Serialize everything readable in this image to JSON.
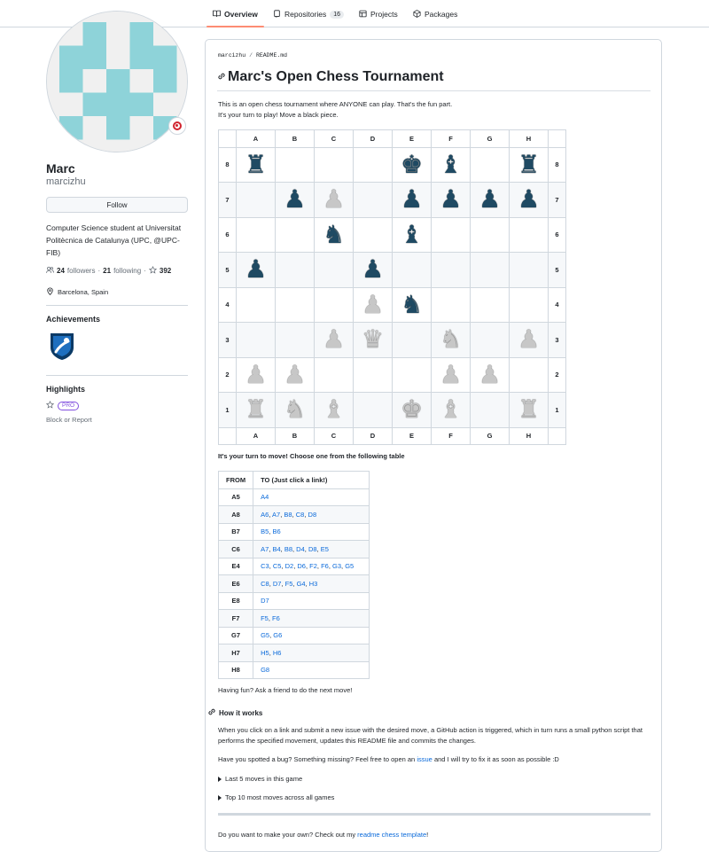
{
  "nav": {
    "tabs": [
      {
        "label": "Overview",
        "icon": "book-icon",
        "selected": true
      },
      {
        "label": "Repositories",
        "icon": "repo-icon",
        "count": "16"
      },
      {
        "label": "Projects",
        "icon": "table-icon"
      },
      {
        "label": "Packages",
        "icon": "package-icon"
      }
    ]
  },
  "profile": {
    "name": "Marc",
    "login": "marcizhu",
    "follow_label": "Follow",
    "bio": "Computer Science student at Universitat Politècnica de Catalunya (UPC, @UPC-FIB)",
    "followers_count": "24",
    "followers_label": "followers",
    "dot": "·",
    "following_count": "21",
    "following_label": "following",
    "stars_count": "392",
    "location": "Barcelona, Spain",
    "achievements_heading": "Achievements",
    "highlights_heading": "Highlights",
    "pro_label": "PRO",
    "block_label": "Block or Report",
    "avatar_color": "#8ed3d9"
  },
  "readme": {
    "breadcrumb_owner": "marcizhu",
    "breadcrumb_sep": "/",
    "breadcrumb_file": "README.md",
    "title": "Marc's Open Chess Tournament",
    "intro_1": "This is an open chess tournament where ANYONE can play. That's the fun part.",
    "intro_2": "It's your turn to play! Move a black piece.",
    "board": {
      "files": [
        "A",
        "B",
        "C",
        "D",
        "E",
        "F",
        "G",
        "H"
      ],
      "rows": [
        {
          "rank": "8",
          "squares": [
            "bR",
            "",
            "",
            "",
            "bK",
            "bB",
            "",
            "bR"
          ]
        },
        {
          "rank": "7",
          "squares": [
            "",
            "bP",
            "wP",
            "",
            "bP",
            "bP",
            "bP",
            "bP"
          ]
        },
        {
          "rank": "6",
          "squares": [
            "",
            "",
            "bN",
            "",
            "bB",
            "",
            "",
            ""
          ]
        },
        {
          "rank": "5",
          "squares": [
            "bP",
            "",
            "",
            "bP",
            "",
            "",
            "",
            ""
          ]
        },
        {
          "rank": "4",
          "squares": [
            "",
            "",
            "",
            "wP",
            "bN",
            "",
            "",
            ""
          ]
        },
        {
          "rank": "3",
          "squares": [
            "",
            "",
            "wP",
            "wQ",
            "",
            "wN",
            "",
            "wP"
          ]
        },
        {
          "rank": "2",
          "squares": [
            "wP",
            "wP",
            "",
            "",
            "",
            "wP",
            "wP",
            ""
          ]
        },
        {
          "rank": "1",
          "squares": [
            "wR",
            "wN",
            "wB",
            "",
            "wK",
            "wB",
            "",
            "wR"
          ]
        }
      ]
    },
    "turn_text": "It's your turn to move! Choose one from the following table",
    "moves_header_from": "FROM",
    "moves_header_to": "TO (Just click a link!)",
    "moves": [
      {
        "from": "A5",
        "to": [
          "A4"
        ]
      },
      {
        "from": "A8",
        "to": [
          "A6",
          "A7",
          "B8",
          "C8",
          "D8"
        ]
      },
      {
        "from": "B7",
        "to": [
          "B5",
          "B6"
        ]
      },
      {
        "from": "C6",
        "to": [
          "A7",
          "B4",
          "B8",
          "D4",
          "D8",
          "E5"
        ]
      },
      {
        "from": "E4",
        "to": [
          "C3",
          "C5",
          "D2",
          "D6",
          "F2",
          "F6",
          "G3",
          "G5"
        ]
      },
      {
        "from": "E6",
        "to": [
          "C8",
          "D7",
          "F5",
          "G4",
          "H3"
        ]
      },
      {
        "from": "E8",
        "to": [
          "D7"
        ]
      },
      {
        "from": "F7",
        "to": [
          "F5",
          "F6"
        ]
      },
      {
        "from": "G7",
        "to": [
          "G5",
          "G6"
        ]
      },
      {
        "from": "H7",
        "to": [
          "H5",
          "H6"
        ]
      },
      {
        "from": "H8",
        "to": [
          "G8"
        ]
      }
    ],
    "fun_text": "Having fun? Ask a friend to do the next move!",
    "how_heading": "How it works",
    "how_text": "When you click on a link and submit a new issue with the desired move, a GitHub action is triggered, which in turn runs a small python script that performs the specified movement, updates this README file and commits the changes.",
    "bug_text_before": "Have you spotted a bug? Something missing? Feel free to open an",
    "bug_link": "issue",
    "bug_text_after": "and I will try to fix it as soon as possible :D",
    "details_1": "Last 5 moves in this game",
    "details_2": "Top 10 most moves across all games",
    "footer_before": "Do you want to make your own? Check out my",
    "footer_link": "readme chess template",
    "footer_after": "!"
  }
}
